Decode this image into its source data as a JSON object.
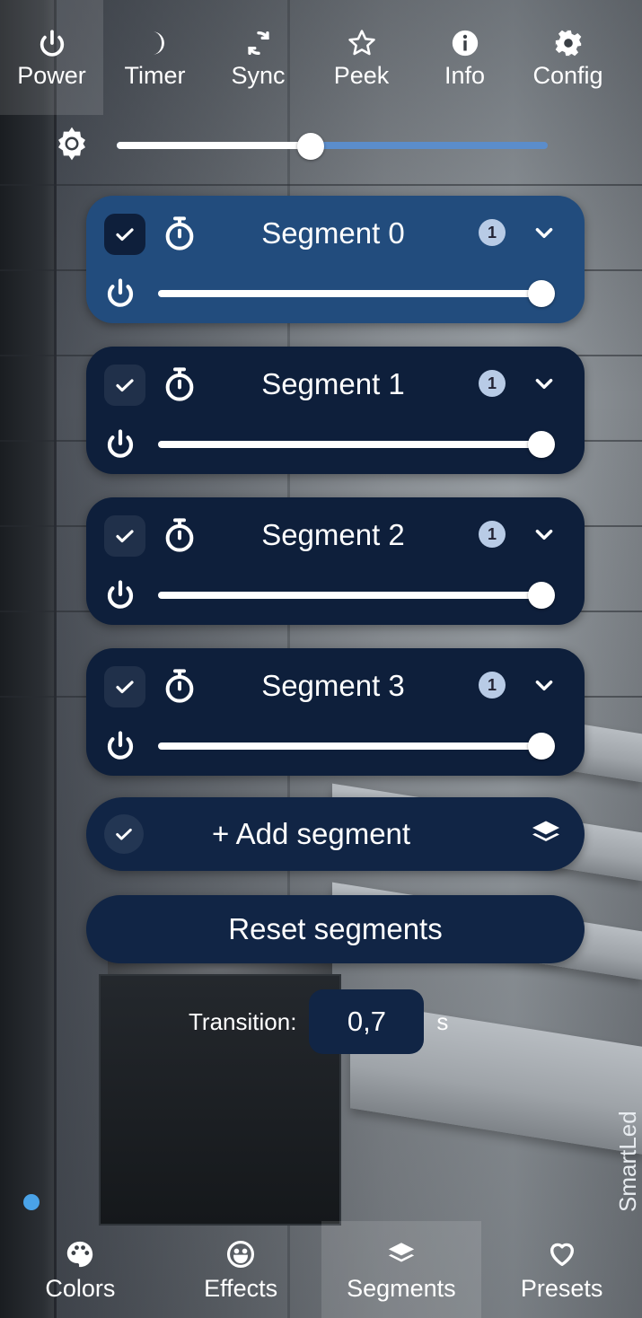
{
  "top_nav": {
    "items": [
      {
        "label": "Power",
        "icon": "power-icon",
        "active": true
      },
      {
        "label": "Timer",
        "icon": "moon-icon",
        "active": false
      },
      {
        "label": "Sync",
        "icon": "sync-icon",
        "active": false
      },
      {
        "label": "Peek",
        "icon": "star-icon",
        "active": false
      },
      {
        "label": "Info",
        "icon": "info-icon",
        "active": false
      },
      {
        "label": "Config",
        "icon": "gear-icon",
        "active": false
      }
    ]
  },
  "brightness": {
    "icon": "brightness-icon",
    "value": 0.45
  },
  "segments": [
    {
      "name": "Segment 0",
      "badge": "1",
      "selected": true,
      "checked": true,
      "level": 1.0
    },
    {
      "name": "Segment 1",
      "badge": "1",
      "selected": false,
      "checked": true,
      "level": 1.0
    },
    {
      "name": "Segment 2",
      "badge": "1",
      "selected": false,
      "checked": true,
      "level": 1.0
    },
    {
      "name": "Segment 3",
      "badge": "1",
      "selected": false,
      "checked": true,
      "level": 1.0
    }
  ],
  "add_segment": {
    "label": "+ Add segment"
  },
  "reset_segments": {
    "label": "Reset segments"
  },
  "transition": {
    "label": "Transition:",
    "value": "0,7",
    "unit": "s"
  },
  "brand": "SmartLed",
  "bottom_nav": {
    "items": [
      {
        "label": "Colors",
        "icon": "palette-icon",
        "active": false
      },
      {
        "label": "Effects",
        "icon": "smiley-icon",
        "active": false
      },
      {
        "label": "Segments",
        "icon": "layers-icon",
        "active": true
      },
      {
        "label": "Presets",
        "icon": "heart-icon",
        "active": false
      }
    ]
  },
  "colors": {
    "segment_bg": "#0e1f3b",
    "segment_selected_bg": "#224c7d",
    "slider_accent": "#5b8dcb",
    "badge": "#b8cbe6"
  }
}
